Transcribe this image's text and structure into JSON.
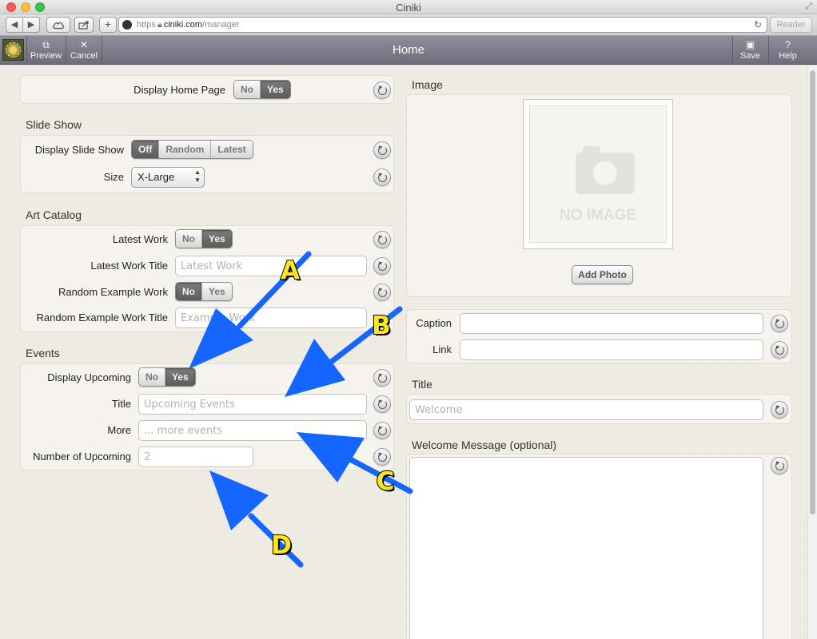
{
  "window": {
    "title": "Ciniki"
  },
  "browser": {
    "url_scheme": "https",
    "url_host": "ciniki.com",
    "url_path": "/manager",
    "reader_label": "Reader"
  },
  "header": {
    "title": "Home",
    "preview_label": "Preview",
    "cancel_label": "Cancel",
    "save_label": "Save",
    "help_label": "Help"
  },
  "left": {
    "home": {
      "label": "Display Home Page",
      "options": [
        "No",
        "Yes"
      ],
      "selected": "Yes"
    },
    "slideshow": {
      "title": "Slide Show",
      "display_label": "Display Slide Show",
      "display_options": [
        "Off",
        "Random",
        "Latest"
      ],
      "display_selected": "Off",
      "size_label": "Size",
      "size_value": "X-Large"
    },
    "art_catalog": {
      "title": "Art Catalog",
      "latest_work_label": "Latest Work",
      "latest_work_options": [
        "No",
        "Yes"
      ],
      "latest_work_selected": "Yes",
      "latest_work_title_label": "Latest Work Title",
      "latest_work_title_placeholder": "Latest Work",
      "random_label": "Random Example Work",
      "random_options": [
        "No",
        "Yes"
      ],
      "random_selected": "No",
      "random_title_label": "Random Example Work Title",
      "random_title_placeholder": "Example Work"
    },
    "events": {
      "title": "Events",
      "display_label": "Display Upcoming",
      "display_options": [
        "No",
        "Yes"
      ],
      "display_selected": "Yes",
      "title_label": "Title",
      "title_placeholder": "Upcoming Events",
      "more_label": "More",
      "more_placeholder": "... more events",
      "number_label": "Number of Upcoming",
      "number_placeholder": "2"
    }
  },
  "right": {
    "image": {
      "title": "Image",
      "no_image_text": "NO IMAGE",
      "add_photo_label": "Add Photo"
    },
    "caption_label": "Caption",
    "link_label": "Link",
    "title_section": {
      "title": "Title",
      "placeholder": "Welcome"
    },
    "welcome": {
      "title": "Welcome Message (optional)"
    }
  },
  "annotations": {
    "color": "#1565ff",
    "callouts": [
      "A",
      "B",
      "C",
      "D"
    ]
  }
}
